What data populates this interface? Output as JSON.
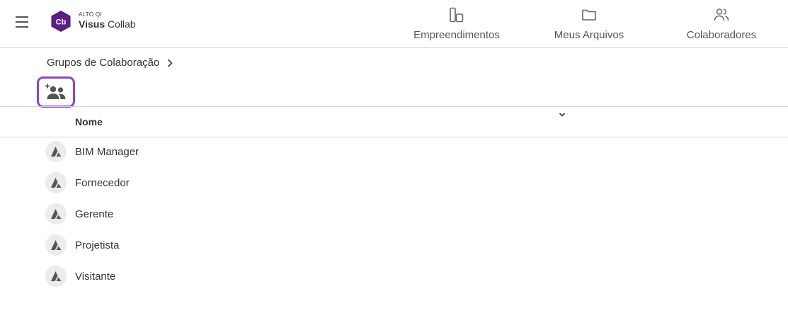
{
  "app": {
    "logo_small": "ALTO QI",
    "logo_bold": "Visus",
    "logo_light": "Collab",
    "logo_mark": "Cb",
    "brand_color": "#5c1f8a"
  },
  "nav": [
    {
      "label": "Empreendimentos",
      "icon": "building-icon"
    },
    {
      "label": "Meus Arquivos",
      "icon": "folder-icon"
    },
    {
      "label": "Colaboradores",
      "icon": "people-icon"
    }
  ],
  "breadcrumb": {
    "label": "Grupos de Colaboração"
  },
  "toolbar": {
    "add_group_icon": "group-add-icon",
    "highlight_color": "#8e45c9"
  },
  "table": {
    "columns": [
      {
        "label": "Nome"
      }
    ],
    "rows": [
      {
        "name": "BIM Manager"
      },
      {
        "name": "Fornecedor"
      },
      {
        "name": "Gerente"
      },
      {
        "name": "Projetista"
      },
      {
        "name": "Visitante"
      }
    ]
  }
}
